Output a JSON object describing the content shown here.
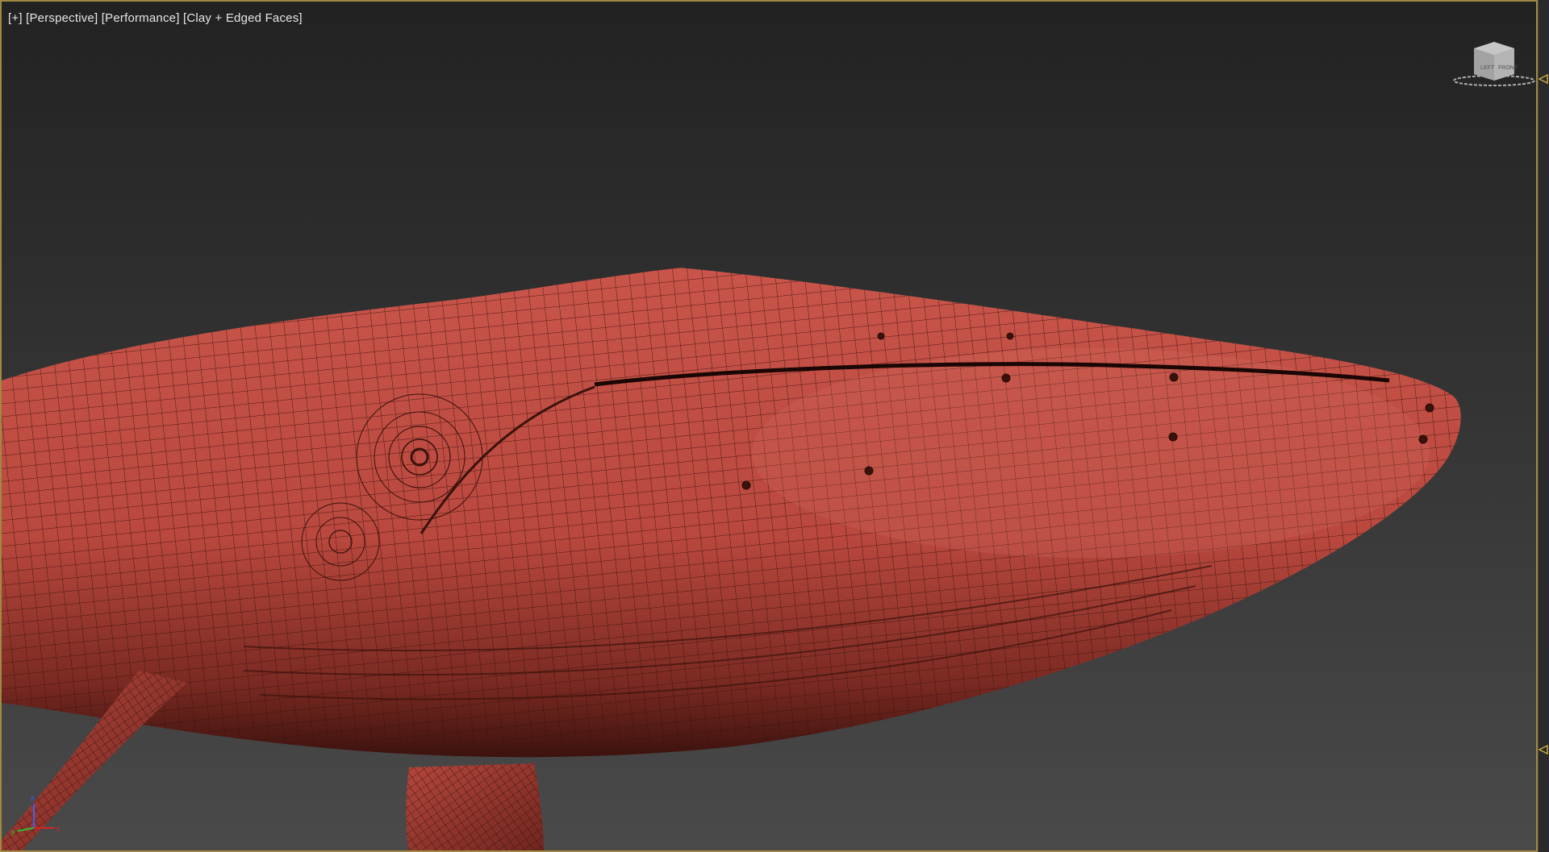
{
  "viewport": {
    "label_plus": "[+]",
    "label_view": "[Perspective]",
    "label_mode": "[Performance]",
    "label_shading": "[Clay + Edged Faces]"
  },
  "viewcube": {
    "icon": "viewcube-icon",
    "face_left": "LEFT",
    "face_front": "FRONT"
  },
  "axis": {
    "x": "x",
    "y": "y",
    "z": "z"
  },
  "colors": {
    "mesh": "#b84a3a",
    "wire": "#3a120c",
    "border": "#a08a43"
  }
}
